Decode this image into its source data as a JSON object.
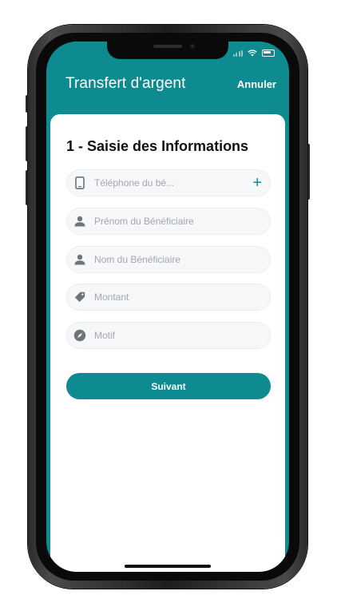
{
  "header": {
    "title": "Transfert d'argent",
    "cancel_label": "Annuler"
  },
  "form": {
    "step_title": "1 - Saisie des Informations",
    "fields": [
      {
        "icon": "phone-icon",
        "placeholder": "Téléphone du bé...",
        "value": "",
        "has_add": true,
        "add_label": "+"
      },
      {
        "icon": "person-icon",
        "placeholder": "Prénom du Bénéficiaire",
        "value": ""
      },
      {
        "icon": "person-icon",
        "placeholder": "Nom du Bénéficiaire",
        "value": ""
      },
      {
        "icon": "tag-icon",
        "placeholder": "Montant",
        "value": ""
      },
      {
        "icon": "compass-icon",
        "placeholder": "Motif",
        "value": ""
      }
    ],
    "submit_label": "Suivant"
  },
  "colors": {
    "accent": "#0e8a91",
    "field_bg": "#f6f7f8",
    "placeholder": "#a3a7ad",
    "icon": "#6e747b"
  }
}
